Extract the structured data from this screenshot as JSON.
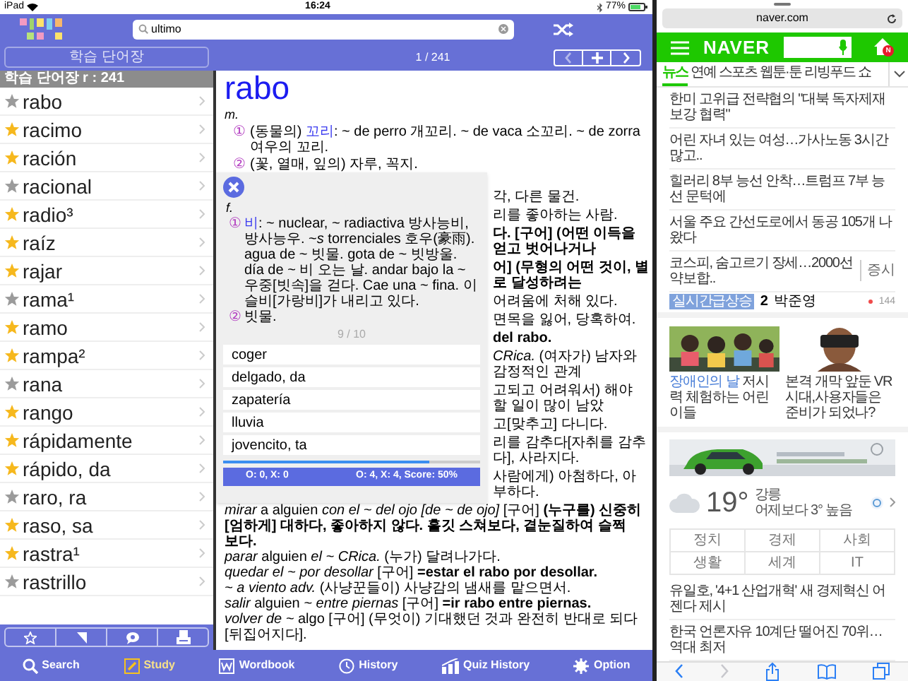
{
  "status_bar": {
    "device": "iPad",
    "time": "16:24",
    "battery": "77%"
  },
  "dictionary": {
    "search": {
      "value": "ultimo"
    },
    "wordbook_button": "학습 단어장",
    "counter": "1 / 241",
    "list_title": "학습 단어장 r : 241",
    "words": [
      {
        "text": "rabo",
        "starred": false
      },
      {
        "text": "racimo",
        "starred": true
      },
      {
        "text": "ración",
        "starred": true
      },
      {
        "text": "racional",
        "starred": false
      },
      {
        "text": "radio³",
        "starred": true
      },
      {
        "text": "raíz",
        "starred": true
      },
      {
        "text": "rajar",
        "starred": true
      },
      {
        "text": "rama¹",
        "starred": false
      },
      {
        "text": "ramo",
        "starred": true
      },
      {
        "text": "rampa²",
        "starred": true
      },
      {
        "text": "rana",
        "starred": false
      },
      {
        "text": "rango",
        "starred": true
      },
      {
        "text": "rápidamente",
        "starred": true
      },
      {
        "text": "rápido, da",
        "starred": true
      },
      {
        "text": "raro, ra",
        "starred": false
      },
      {
        "text": "raso, sa",
        "starred": true
      },
      {
        "text": "rastra¹",
        "starred": true
      },
      {
        "text": "rastrillo",
        "starred": false
      }
    ],
    "entry": {
      "headword": "rabo",
      "lines": [
        {
          "kind": "pos",
          "text": "m."
        },
        {
          "kind": "sense",
          "num": "①",
          "lead": "(동물의) ",
          "highlight": "꼬리",
          "text": ": ~ de perro 개꼬리. ~ de vaca 소꼬리. ~ de zorra 여우의 꼬리."
        },
        {
          "kind": "sense",
          "num": "②",
          "text": "(꽃, 열매, 잎의) 자루, 꼭지."
        },
        {
          "kind": "partial",
          "text": "각, 다른 물건."
        },
        {
          "kind": "partial",
          "text": "리를 좋아하는 사람."
        },
        {
          "kind": "partial",
          "text": "**다. [구어] (어떤 이득을 얻고 벗어나거나**"
        },
        {
          "kind": "partial",
          "text": "**어] (무형의 어떤 것이, 별로 달성하려는**"
        },
        {
          "kind": "partial",
          "text": "어려움에 처해 있다."
        },
        {
          "kind": "partial",
          "text": "면목을 잃어, 당혹하여."
        },
        {
          "kind": "partial",
          "text": "**del rabo.**"
        },
        {
          "kind": "partial",
          "text": "*CRica.* (여자가) 남자와 감정적인 관계"
        },
        {
          "kind": "partial",
          "text": "고되고 어려워서) 해야 할 일이 많이 남았"
        },
        {
          "kind": "partial",
          "text": "고[맞추고] 다니다."
        },
        {
          "kind": "partial",
          "text": "리를 감추다[자취를 감추다], 사라지다."
        },
        {
          "kind": "partial",
          "text": "사람에게) 아첨하다, 아부하다."
        },
        {
          "kind": "phrase",
          "text": "*mirar* a alguien *con el ~ del ojo [de ~ de ojo]* [구어] **(누구를) 신중히[엄하게] 대하다, 좋아하지 않다. 흘깃 스쳐보다, 곁눈질하여 슬쩍 보다.**"
        },
        {
          "kind": "phrase",
          "text": "*parar* alguien *el ~  CRica.* (누가) 달려나가다."
        },
        {
          "kind": "phrase",
          "text": "*quedar el ~ por desollar* [구어] **=estar el rabo por desollar.**"
        },
        {
          "kind": "phrase",
          "text": "*~ a viento  adv.* (사냥꾼들이) 사냥감의 냄새를 맡으면서."
        },
        {
          "kind": "phrase",
          "text": "*salir* alguien *~ entre piernas* [구어] **=ir rabo entre piernas.**"
        },
        {
          "kind": "phrase",
          "text": "*volver de ~* algo [구어] (무엇이) 기대했던 것과 완전히 반대로 되다[뒤집어지다]."
        }
      ]
    },
    "quiz": {
      "pos": "f.",
      "senses": [
        {
          "num": "①",
          "highlight": "비",
          "text": ": ~ nuclear, ~ radiactiva 방사능비, 방사능우. ~*s* torrenciales 호우(豪雨). agua de ~ 빗물. gota de ~ 빗방울. día de ~ 비 오는 날. andar bajo la ~ 우중[빗속]을 걷다. Cae una ~ fina. 이슬비[가랑비]가 내리고 있다."
        },
        {
          "num": "②",
          "text": "빗물."
        }
      ],
      "progress_text": "9 / 10",
      "options": [
        "coger",
        "delgado, da",
        "zapatería",
        "lluvia",
        "jovencito, ta"
      ],
      "level": 0.8,
      "score_left": "O: 0, X: 0",
      "score_right": "O: 4, X: 4, Score: 50%"
    },
    "tabs": [
      {
        "label": "Search",
        "selected": false
      },
      {
        "label": "Study",
        "selected": true
      },
      {
        "label": "Wordbook",
        "selected": false
      },
      {
        "label": "History",
        "selected": false
      },
      {
        "label": "Quiz History",
        "selected": false
      },
      {
        "label": "Option",
        "selected": false
      }
    ]
  },
  "browser": {
    "url": "naver.com",
    "logo": "NAVER",
    "badge": "N",
    "tabs": [
      {
        "label": "뉴스",
        "selected": true
      },
      {
        "label": "연예",
        "selected": false
      },
      {
        "label": "스포츠",
        "selected": false
      },
      {
        "label": "웹툰·툰",
        "selected": false
      },
      {
        "label": "리빙푸드",
        "selected": false
      },
      {
        "label": "쇼",
        "selected": false
      }
    ],
    "headlines": [
      {
        "text": "한미 고위급 전략협의 \"대북 독자제재 보강 협력\""
      },
      {
        "text": "어린 자녀 있는 여성…가사노동 3시간 많고.."
      },
      {
        "text": "힐러리 8부 능선 안착…트럼프 7부 능선 문턱에"
      },
      {
        "text": "서울 주요 간선도로에서 동공 105개 나왔다"
      },
      {
        "text": "코스피, 숨고르기 장세…2000선 약보합..",
        "tag": "증시"
      }
    ],
    "trending": {
      "badge": "실시간급상승",
      "rank": "2",
      "keyword": "박준영",
      "count": "144"
    },
    "photo_news": [
      {
        "highlight": "장애인의 날",
        "caption": "저시력 체험하는 어린이들"
      },
      {
        "caption": "본격 개막 앞둔 VR시대,사용자들은 준비가 되었나?"
      }
    ],
    "weather": {
      "temp": "19°",
      "place": "강릉",
      "note": "어제보다 3° 높음"
    },
    "categories": [
      "정치",
      "경제",
      "사회",
      "생활",
      "세계",
      "IT"
    ],
    "news": [
      "유일호, '4+1 산업개혁' 새 경제혁신 어젠다 제시",
      "한국 언론자유 10계단 떨어진 70위…역대 최저"
    ],
    "forward_disabled": true
  }
}
